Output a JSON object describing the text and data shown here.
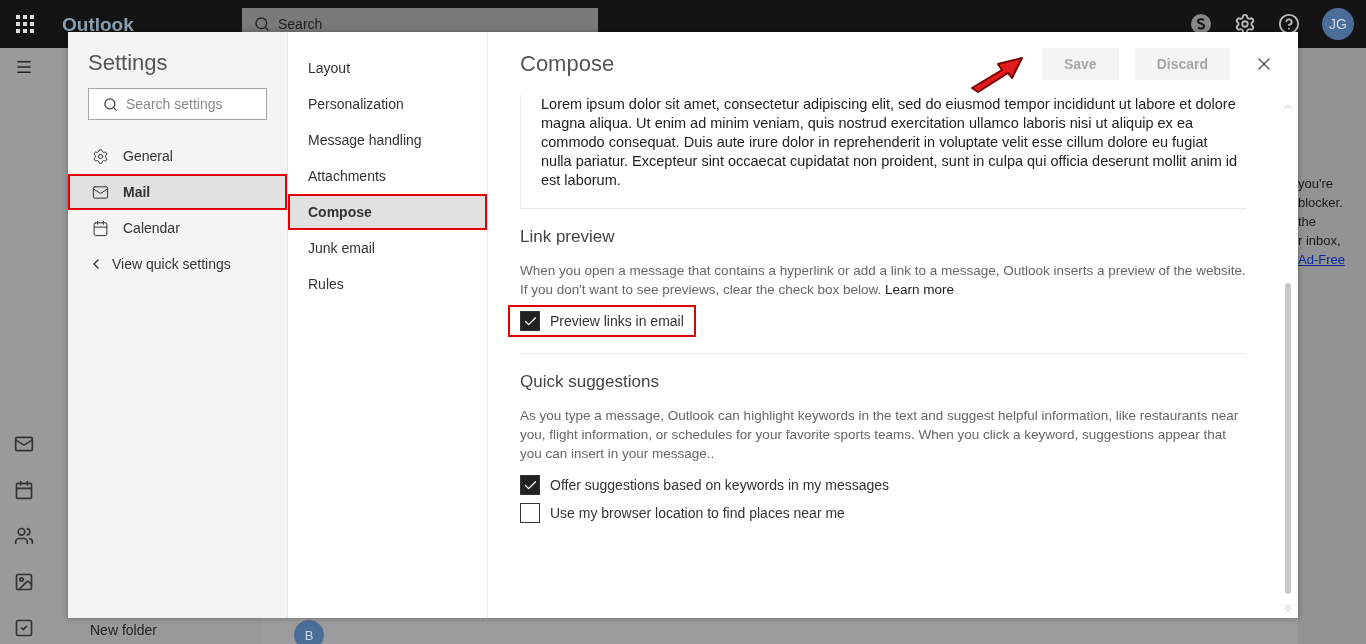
{
  "app_bar": {
    "app_name": "Outlook",
    "search_placeholder": "Search",
    "avatar_initials": "JG"
  },
  "background": {
    "folder_item": "New folder",
    "reading_pane_lines": [
      "you're",
      "blocker.",
      "the",
      "r inbox,"
    ],
    "reading_pane_link": "Ad-Free",
    "sender_initial": "B"
  },
  "settings": {
    "title": "Settings",
    "search_placeholder": "Search settings",
    "categories": [
      {
        "label": "General",
        "selected": false,
        "highlighted": false
      },
      {
        "label": "Mail",
        "selected": true,
        "highlighted": true
      },
      {
        "label": "Calendar",
        "selected": false,
        "highlighted": false
      }
    ],
    "back_link": "View quick settings",
    "subcategories": [
      {
        "label": "Layout",
        "selected": false,
        "highlighted": false
      },
      {
        "label": "Personalization",
        "selected": false,
        "highlighted": false
      },
      {
        "label": "Message handling",
        "selected": false,
        "highlighted": false
      },
      {
        "label": "Attachments",
        "selected": false,
        "highlighted": false
      },
      {
        "label": "Compose",
        "selected": true,
        "highlighted": true
      },
      {
        "label": "Junk email",
        "selected": false,
        "highlighted": false
      },
      {
        "label": "Rules",
        "selected": false,
        "highlighted": false
      }
    ],
    "page_title": "Compose",
    "buttons": [
      {
        "label": "Save",
        "disabled": true
      },
      {
        "label": "Discard",
        "disabled": true
      }
    ],
    "signature_text": "Lorem ipsum dolor sit amet, consectetur adipiscing elit, sed do eiusmod tempor incididunt ut labore et dolore magna aliqua. Ut enim ad minim veniam, quis nostrud exercitation ullamco laboris nisi ut aliquip ex ea commodo consequat. Duis aute irure dolor in reprehenderit in voluptate velit esse cillum dolore eu fugiat nulla pariatur. Excepteur sint occaecat cupidatat non proident, sunt in culpa qui officia deserunt mollit anim id est laborum.",
    "sections": [
      {
        "title": "Link preview",
        "description": "When you open a message that contains a hyperlink or add a link to a message, Outlook inserts a preview of the website. If you don't want to see previews, clear the check box below.",
        "link": "Learn more",
        "options": [
          {
            "label": "Preview links in email",
            "checked": true,
            "highlighted": true
          }
        ]
      },
      {
        "title": "Quick suggestions",
        "description": "As you type a message, Outlook can highlight keywords in the text and suggest helpful information, like restaurants near you, flight information, or schedules for your favorite sports teams. When you click a keyword, suggestions appear that you can insert in your message..",
        "options": [
          {
            "label": "Offer suggestions based on keywords in my messages",
            "checked": true,
            "highlighted": false
          },
          {
            "label": "Use my browser location to find places near me",
            "checked": false,
            "highlighted": false
          }
        ]
      }
    ]
  }
}
